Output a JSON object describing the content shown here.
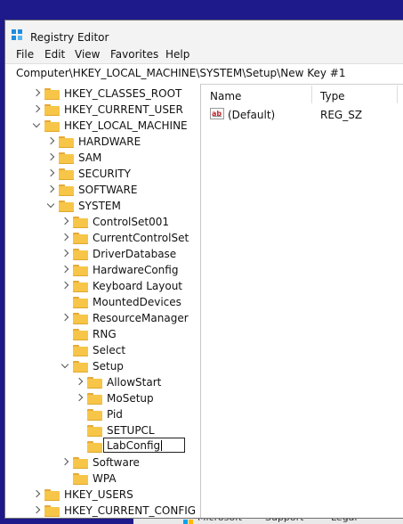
{
  "window": {
    "title": "Registry Editor"
  },
  "menu": [
    "File",
    "Edit",
    "View",
    "Favorites",
    "Help"
  ],
  "address": "Computer\\HKEY_LOCAL_MACHINE\\SYSTEM\\Setup\\New Key #1",
  "tree": [
    {
      "label": "HKEY_CLASSES_ROOT",
      "level": 0,
      "chevron": "right"
    },
    {
      "label": "HKEY_CURRENT_USER",
      "level": 0,
      "chevron": "right"
    },
    {
      "label": "HKEY_LOCAL_MACHINE",
      "level": 0,
      "chevron": "down"
    },
    {
      "label": "HARDWARE",
      "level": 1,
      "chevron": "right"
    },
    {
      "label": "SAM",
      "level": 1,
      "chevron": "right"
    },
    {
      "label": "SECURITY",
      "level": 1,
      "chevron": "right"
    },
    {
      "label": "SOFTWARE",
      "level": 1,
      "chevron": "right"
    },
    {
      "label": "SYSTEM",
      "level": 1,
      "chevron": "down"
    },
    {
      "label": "ControlSet001",
      "level": 2,
      "chevron": "right"
    },
    {
      "label": "CurrentControlSet",
      "level": 2,
      "chevron": "right"
    },
    {
      "label": "DriverDatabase",
      "level": 2,
      "chevron": "right"
    },
    {
      "label": "HardwareConfig",
      "level": 2,
      "chevron": "right"
    },
    {
      "label": "Keyboard Layout",
      "level": 2,
      "chevron": "right"
    },
    {
      "label": "MountedDevices",
      "level": 2,
      "chevron": "none"
    },
    {
      "label": "ResourceManager",
      "level": 2,
      "chevron": "right"
    },
    {
      "label": "RNG",
      "level": 2,
      "chevron": "none"
    },
    {
      "label": "Select",
      "level": 2,
      "chevron": "none"
    },
    {
      "label": "Setup",
      "level": 2,
      "chevron": "down"
    },
    {
      "label": "AllowStart",
      "level": 3,
      "chevron": "right"
    },
    {
      "label": "MoSetup",
      "level": 3,
      "chevron": "right"
    },
    {
      "label": "Pid",
      "level": 3,
      "chevron": "none"
    },
    {
      "label": "SETUPCL",
      "level": 3,
      "chevron": "none"
    },
    {
      "label": "LabConfig",
      "level": 3,
      "chevron": "none",
      "editing": true
    },
    {
      "label": "Software",
      "level": 2,
      "chevron": "right"
    },
    {
      "label": "WPA",
      "level": 2,
      "chevron": "none"
    },
    {
      "label": "HKEY_USERS",
      "level": 0,
      "chevron": "right"
    },
    {
      "label": "HKEY_CURRENT_CONFIG",
      "level": 0,
      "chevron": "right"
    }
  ],
  "values_pane": {
    "columns": {
      "name": "Name",
      "type": "Type"
    },
    "rows": [
      {
        "name": "(Default)",
        "type": "REG_SZ",
        "icon": "string-value-icon"
      }
    ]
  },
  "background": {
    "items": [
      "Microsoft",
      "Support",
      "Legal"
    ]
  },
  "colors": {
    "folder": "#f7c548",
    "selection": "#cce8ff",
    "desktop": "#1e1a8c"
  }
}
